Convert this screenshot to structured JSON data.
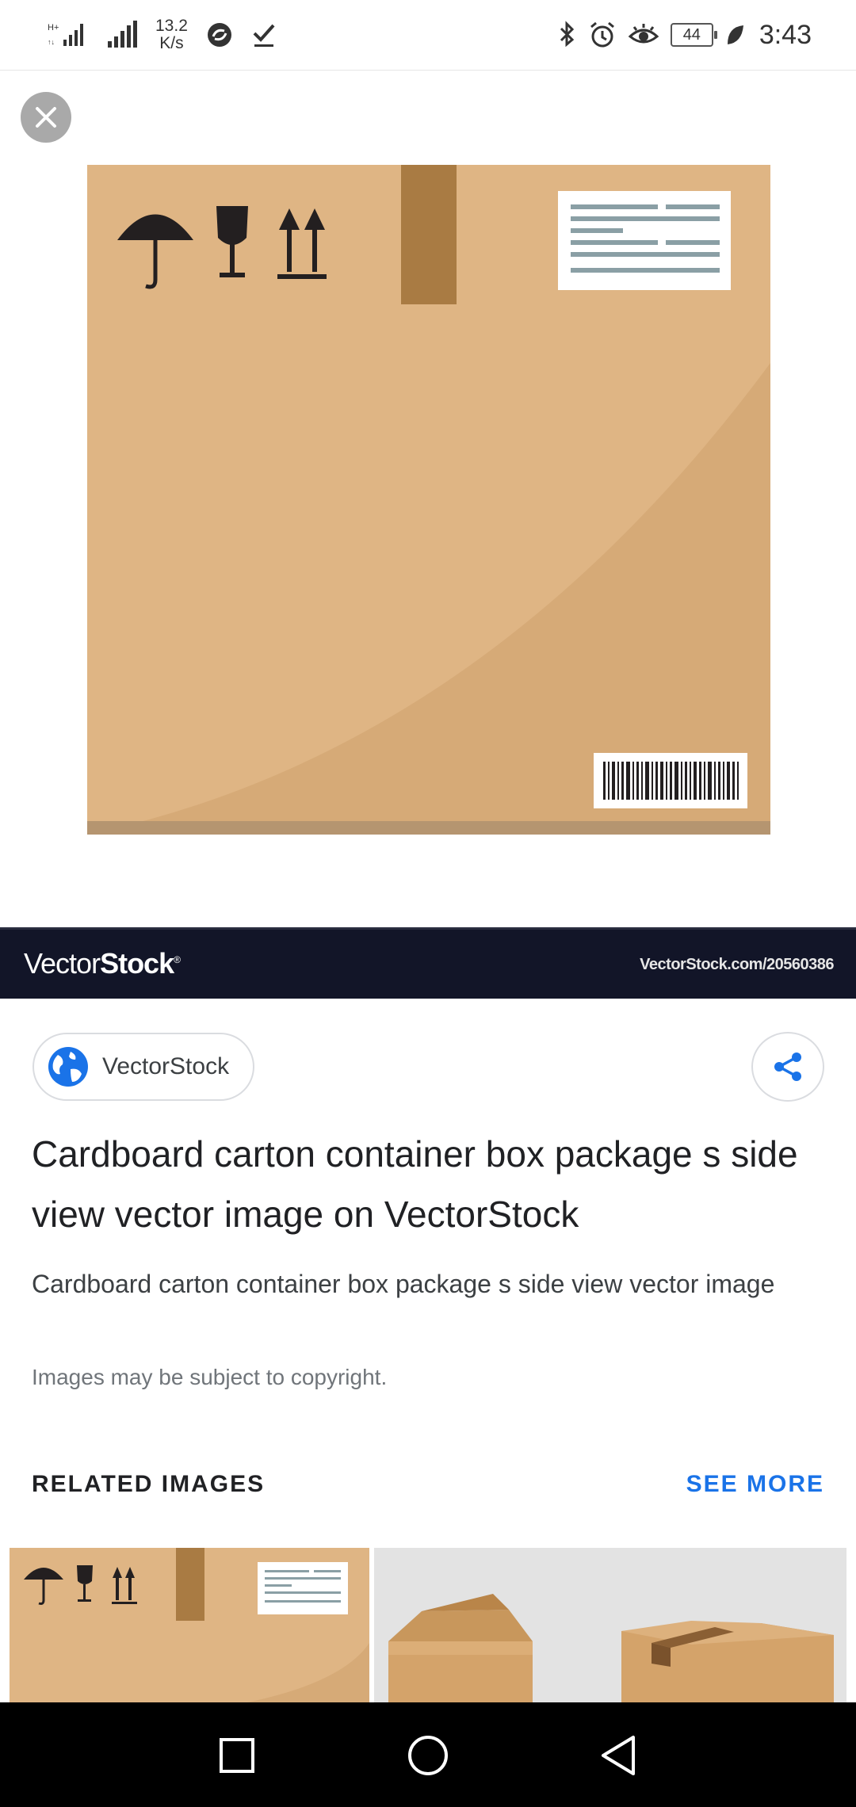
{
  "status_bar": {
    "network_type": "H+",
    "speed_value": "13.2",
    "speed_unit": "K/s",
    "battery": "44",
    "time": "3:43"
  },
  "viewer": {
    "close_label": "Close",
    "watermark_logo_light": "Vector",
    "watermark_logo_bold": "Stock",
    "watermark_url": "VectorStock.com/20560386"
  },
  "source": {
    "name": "VectorStock"
  },
  "details": {
    "title": "Cardboard carton container box package s side view vector image on VectorStock",
    "description": "Cardboard carton container box package s side view vector image",
    "copyright": "Images may be subject to copyright."
  },
  "related": {
    "heading": "RELATED IMAGES",
    "see_more": "SEE MORE"
  },
  "icons": {
    "globe": "globe-icon",
    "share": "share-icon",
    "close": "close-icon"
  },
  "colors": {
    "accent": "#1a73e8",
    "box": "#dfb584",
    "tape": "#a97b43",
    "watermark_bg": "#121528"
  }
}
